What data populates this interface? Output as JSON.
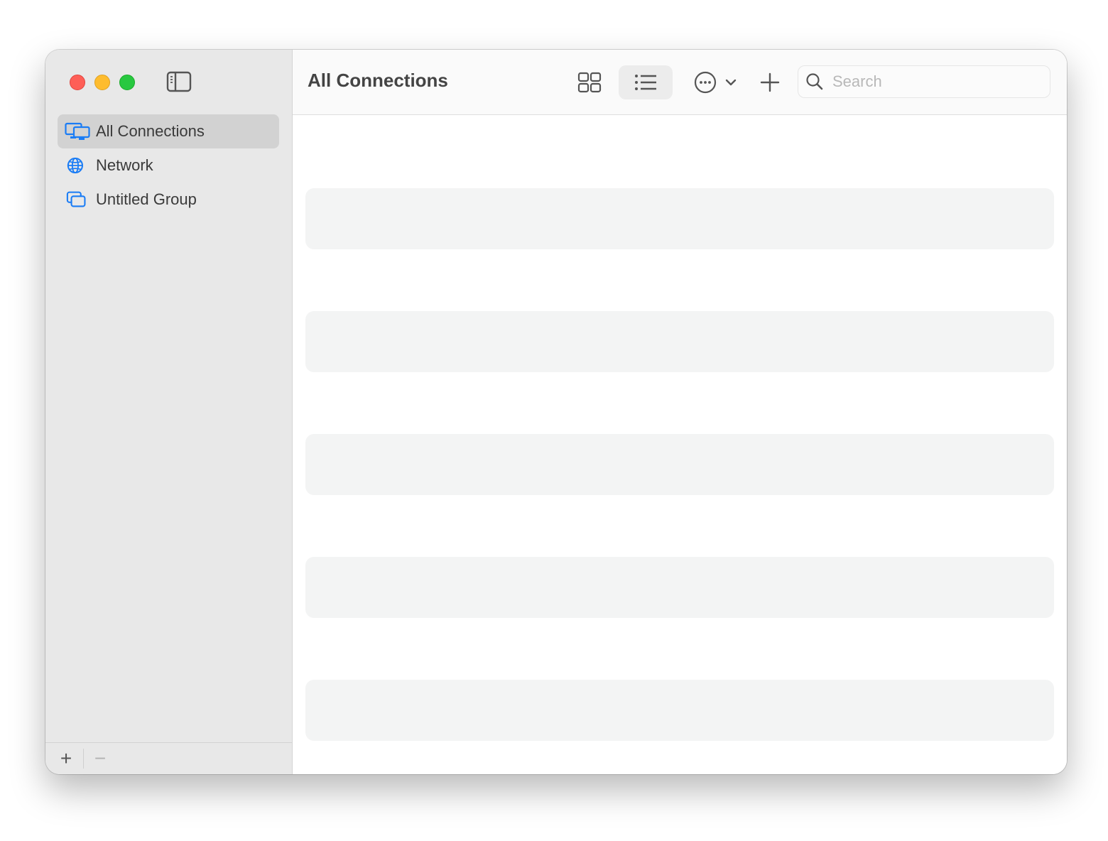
{
  "window": {
    "traffic_lights": [
      {
        "name": "close",
        "color": "#fe5f57"
      },
      {
        "name": "minimize",
        "color": "#febc2e"
      },
      {
        "name": "zoom",
        "color": "#28c840"
      }
    ]
  },
  "sidebar": {
    "items": [
      {
        "label": "All Connections",
        "icon": "displays-icon",
        "selected": true
      },
      {
        "label": "Network",
        "icon": "globe-icon",
        "selected": false
      },
      {
        "label": "Untitled Group",
        "icon": "group-windows-icon",
        "selected": false
      }
    ],
    "footer": {
      "add_label": "+",
      "remove_label": "−"
    }
  },
  "toolbar": {
    "title": "All Connections",
    "view_modes": [
      "grid",
      "list"
    ],
    "active_view": "list",
    "search": {
      "placeholder": "Search",
      "value": ""
    }
  },
  "content": {
    "rows": [
      {},
      {},
      {},
      {},
      {}
    ]
  },
  "colors": {
    "accent": "#1a7cf5",
    "sidebar_bg": "#e8e8e8",
    "row_bg": "#f3f4f4"
  }
}
